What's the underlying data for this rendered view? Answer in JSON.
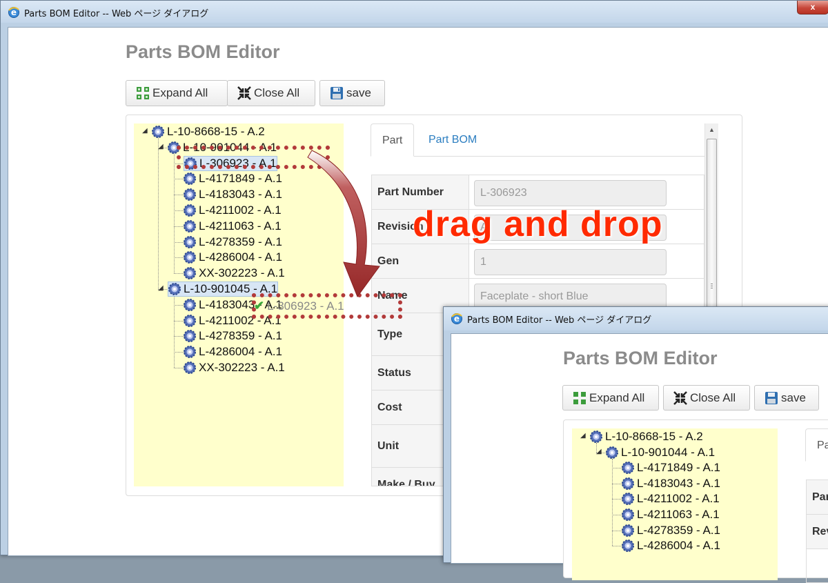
{
  "main_window": {
    "title": "Parts BOM Editor -- Web ページ ダイアログ",
    "close_label": "x",
    "page_title": "Parts BOM Editor",
    "toolbar": {
      "expand_all": "Expand All",
      "close_all": "Close All",
      "save": "save"
    },
    "tree": [
      {
        "label": "L-10-8668-15 - A.2",
        "level": 0
      },
      {
        "label": "L-10-901044 - A.1",
        "level": 1
      },
      {
        "label": "L-306923 - A.1",
        "level": 2,
        "selected": true
      },
      {
        "label": "L-4171849 - A.1",
        "level": 2
      },
      {
        "label": "L-4183043 - A.1",
        "level": 2
      },
      {
        "label": "L-4211002 - A.1",
        "level": 2
      },
      {
        "label": "L-4211063 - A.1",
        "level": 2
      },
      {
        "label": "L-4278359 - A.1",
        "level": 2
      },
      {
        "label": "L-4286004 - A.1",
        "level": 2
      },
      {
        "label": "XX-302223 - A.1",
        "level": 2
      },
      {
        "label": "L-10-901045 - A.1",
        "level": 1,
        "selected": true
      },
      {
        "label": "L-4183043 - A.1",
        "level": 2
      },
      {
        "label": "L-4211002 - A.1",
        "level": 2
      },
      {
        "label": "L-4278359 - A.1",
        "level": 2
      },
      {
        "label": "L-4286004 - A.1",
        "level": 2
      },
      {
        "label": "XX-302223 - A.1",
        "level": 2
      }
    ],
    "drag_ghost": "L-306923 - A.1",
    "tabs": [
      "Part",
      "Part BOM"
    ],
    "form": [
      {
        "label": "Part Number",
        "value": "L-306923"
      },
      {
        "label": "Revision",
        "value": "A"
      },
      {
        "label": "Gen",
        "value": "1"
      },
      {
        "label": "Name",
        "value": "Faceplate - short Blue"
      },
      {
        "label": "Type",
        "value": ""
      },
      {
        "label": "Status",
        "value": ""
      },
      {
        "label": "Cost",
        "value": ""
      },
      {
        "label": "Unit",
        "value": ""
      },
      {
        "label": "Make / Buy",
        "value": ""
      }
    ]
  },
  "overlay": {
    "text": "drag and drop"
  },
  "second_window": {
    "title": "Parts BOM Editor -- Web ページ ダイアログ",
    "page_title": "Parts BOM Editor",
    "toolbar": {
      "expand_all": "Expand All",
      "close_all": "Close All",
      "save": "save"
    },
    "tree": [
      {
        "label": "L-10-8668-15 - A.2",
        "level": 0
      },
      {
        "label": "L-10-901044 - A.1",
        "level": 1
      },
      {
        "label": "L-4171849 - A.1",
        "level": 2
      },
      {
        "label": "L-4183043 - A.1",
        "level": 2
      },
      {
        "label": "L-4211002 - A.1",
        "level": 2
      },
      {
        "label": "L-4211063 - A.1",
        "level": 2
      },
      {
        "label": "L-4278359 - A.1",
        "level": 2
      },
      {
        "label": "L-4286004 - A.1",
        "level": 2
      }
    ],
    "tab_partial": "Pa",
    "form_partial": [
      "Par",
      "Rev"
    ]
  },
  "colors": {
    "tree_bg": "#ffffcc",
    "link_blue": "#2a7dc0",
    "drag_red": "#b23a3a",
    "overlay_red": "#ff2a00"
  }
}
